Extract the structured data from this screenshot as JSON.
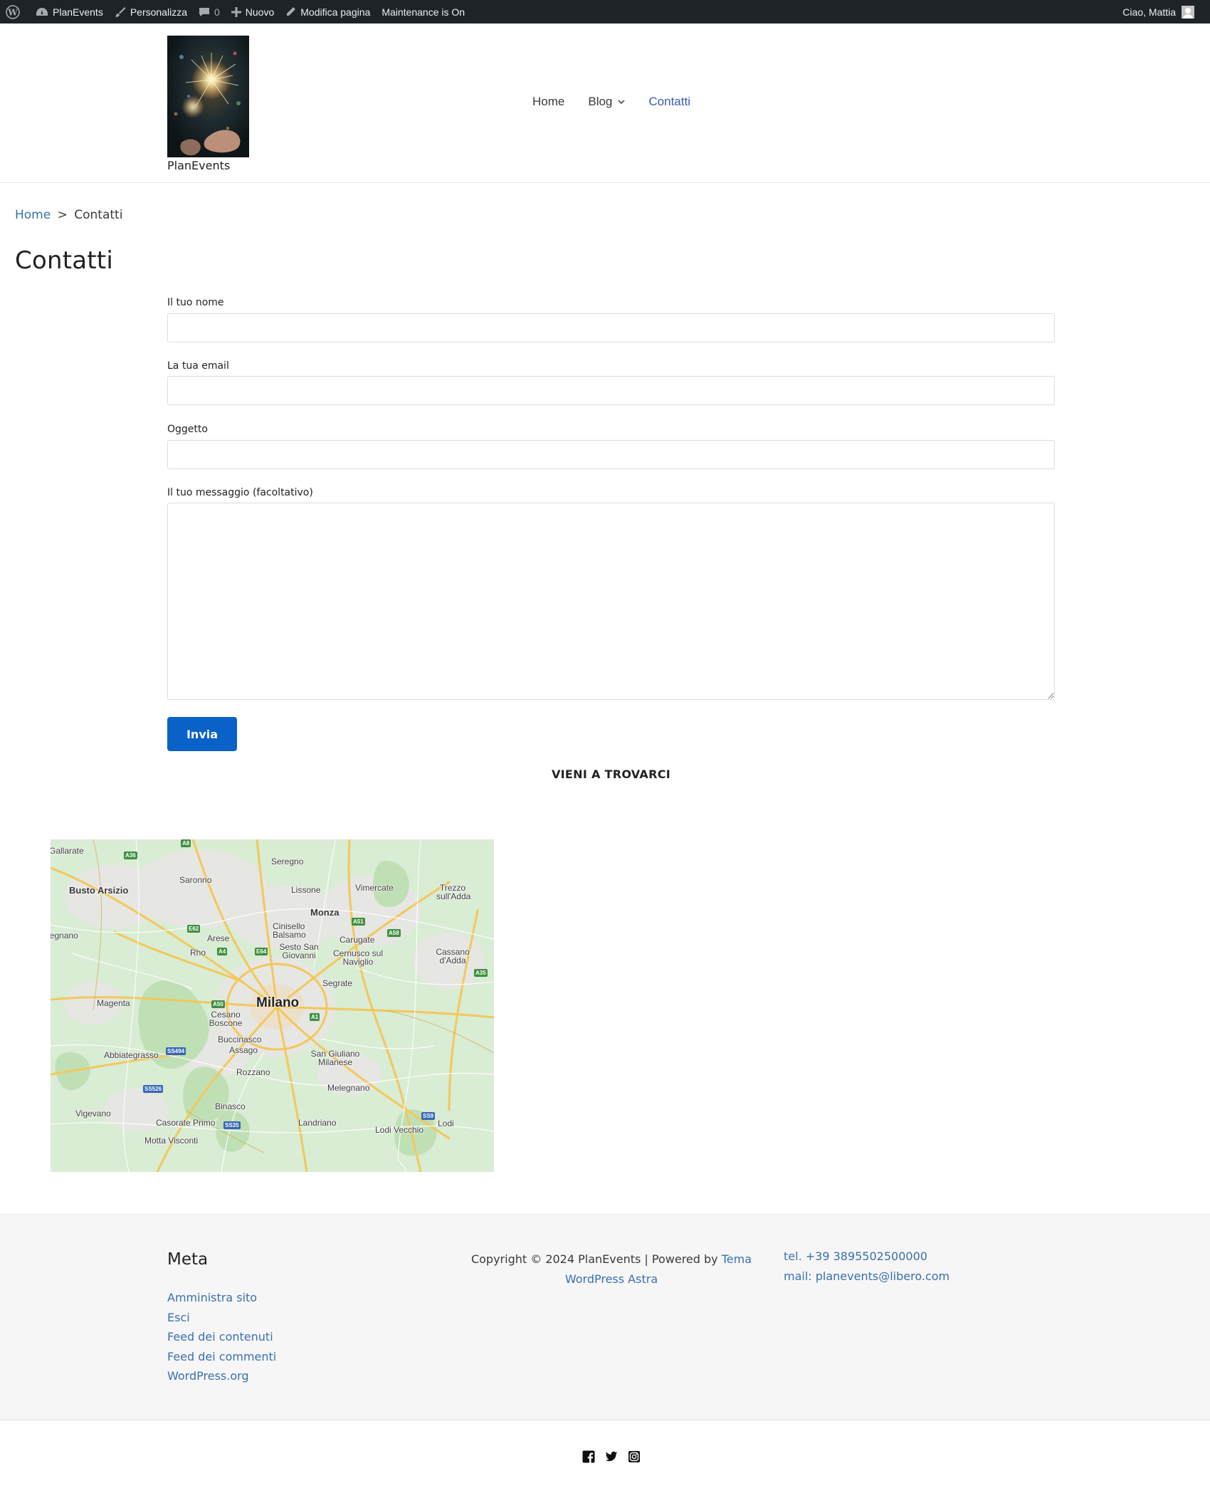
{
  "admin_bar": {
    "site_name": "PlanEvents",
    "customize": "Personalizza",
    "comments_count": "0",
    "new": "Nuovo",
    "edit_page": "Modifica pagina",
    "maintenance": "Maintenance is On",
    "greeting": "Ciao, Mattia"
  },
  "header": {
    "site_title": "PlanEvents",
    "nav": [
      {
        "label": "Home"
      },
      {
        "label": "Blog"
      },
      {
        "label": "Contatti",
        "active": true
      }
    ]
  },
  "breadcrumb": {
    "home": "Home",
    "separator": ">",
    "current": "Contatti"
  },
  "page_title": "Contatti",
  "form": {
    "name_label": "Il tuo nome",
    "email_label": "La tua email",
    "subject_label": "Oggetto",
    "message_label": "Il tuo messaggio (facoltativo)",
    "submit": "Invia"
  },
  "visit_heading": "VIENI A TROVARCI",
  "map": {
    "center_city": "Milano",
    "places": [
      "Gallarate",
      "Seregno",
      "Saronno",
      "Busto Arsizio",
      "Lissone",
      "Vimercate",
      "Trezzo sull'Adda",
      "Monza",
      "Cinisello Balsamo",
      "Sesto San Giovanni",
      "Carugate",
      "Cernusco sul Naviglio",
      "Cassano d'Adda",
      "Arese",
      "Rho",
      "Legnano",
      "Segrate",
      "Magenta",
      "Cesano Boscone",
      "Buccinasco",
      "Assago",
      "Abbiategrasso",
      "San Giuliano Milanese",
      "Rozzano",
      "Melegnano",
      "Binasco",
      "Vigevano",
      "Casorate Primo",
      "Landriano",
      "Lodi Vecchio",
      "Lodi",
      "Motta Visconti"
    ],
    "roads": [
      "A8",
      "A36",
      "E62",
      "E64",
      "A51",
      "A58",
      "A4",
      "A50",
      "A1",
      "A35",
      "SS494",
      "SS526",
      "SS35",
      "SS9"
    ]
  },
  "footer": {
    "meta_title": "Meta",
    "meta_links": [
      "Amministra sito",
      "Esci",
      "Feed dei contenuti",
      "Feed dei commenti",
      "WordPress.org"
    ],
    "copyright_prefix": "Copyright © 2024 PlanEvents | Powered by",
    "copyright_link": "Tema WordPress Astra",
    "phone": "tel. +39 3895502500000",
    "email": "mail: planevents@libero.com"
  },
  "social": [
    "facebook-icon",
    "twitter-icon",
    "instagram-icon"
  ],
  "colors": {
    "admin_bar": "#1d2327",
    "link": "#3a6fb0",
    "button": "#0a62c8",
    "footer_bg": "#f6f6f6"
  }
}
